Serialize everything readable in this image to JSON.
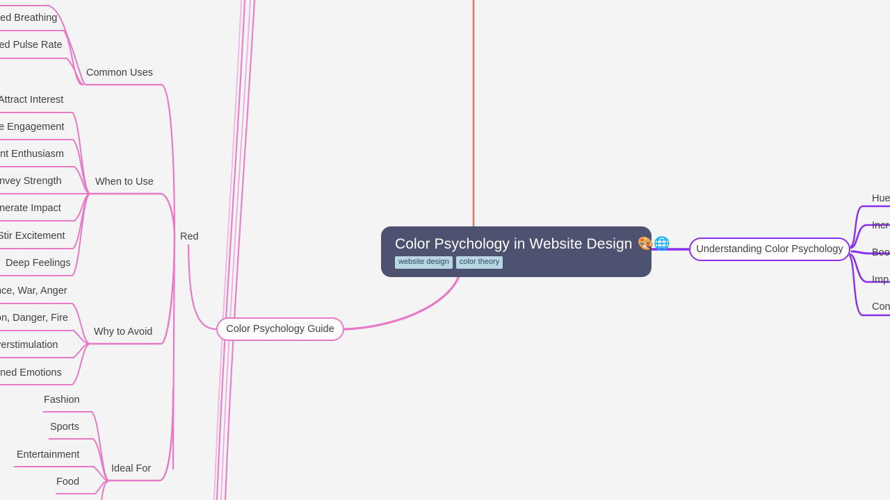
{
  "canvas": {
    "background_color": "#f4f4f5",
    "type": "mindmap"
  },
  "root": {
    "title": "Color Psychology in Website Design",
    "emojis": "🎨🌐",
    "background_color": "#4c5270",
    "text_color": "#ffffff",
    "tags": [
      "website design",
      "color theory"
    ],
    "tag_background_color": "#b9d6e3",
    "tag_text_color": "#2a4d63"
  },
  "branches": {
    "left": {
      "label": "Color Psychology Guide",
      "accent_color": "#e879c8",
      "children": [
        {
          "label": "Red",
          "accent_color": "#e879c8",
          "groups": [
            {
              "label": "Common Uses",
              "children": []
            },
            {
              "label": "When to Use",
              "children": [
                "Attract Interest",
                "Encourage Engagement",
                "Represent Enthusiasm",
                "Convey Strength",
                "Generate Impact",
                "Stir Excitement",
                "Deep Feelings"
              ]
            },
            {
              "label": "Why to Avoid",
              "children": [
                "Violence, War, Anger",
                "Caution, Danger, Fire",
                "Overstimulation",
                "Heightened Emotions"
              ]
            },
            {
              "label": "Ideal For",
              "children": [
                "Fashion",
                "Sports",
                "Entertainment",
                "Food"
              ]
            }
          ],
          "effects": [
            "Quickened Breathing",
            "Raised Pulse Rate"
          ]
        }
      ]
    },
    "right": {
      "label": "Understanding Color Psychology",
      "accent_color": "#8b2ef0",
      "children": [
        "Hue",
        "Incr",
        "Boo",
        "Imp",
        "Con"
      ]
    }
  },
  "clipped_labels": {
    "quickened_breathing": "ened Breathing",
    "raised_pulse_rate": "ised Pulse Rate",
    "attract_interest": "Attract Interest",
    "encourage_engagement": "ge Engagement",
    "represent_enthusiasm": "ent Enthusiasm",
    "convey_strength": "onvey Strength",
    "generate_impact": "enerate Impact",
    "stir_excitement": "Stir Excitement",
    "deep_feelings": "Deep Feelings",
    "violence_war_anger": "nce, War, Anger",
    "caution_danger_fire": "on, Danger, Fire",
    "overstimulation": "verstimulation",
    "heightened_emotions": "ened Emotions",
    "fashion": "Fashion",
    "sports": "Sports",
    "entertainment": "Entertainment",
    "food": "Food",
    "common_uses": "Common Uses",
    "when_to_use": "When to Use",
    "why_to_avoid": "Why to Avoid",
    "ideal_for": "Ideal For",
    "red": "Red",
    "hue": "Hue",
    "incr": "Incr",
    "boo": "Boo",
    "imp": "Imp",
    "con": "Con"
  },
  "colors": {
    "pink_edge": "#e879c8",
    "purple_edge": "#8b2ef0",
    "salmon_edge": "#e4736f",
    "text": "#3f3f46"
  }
}
